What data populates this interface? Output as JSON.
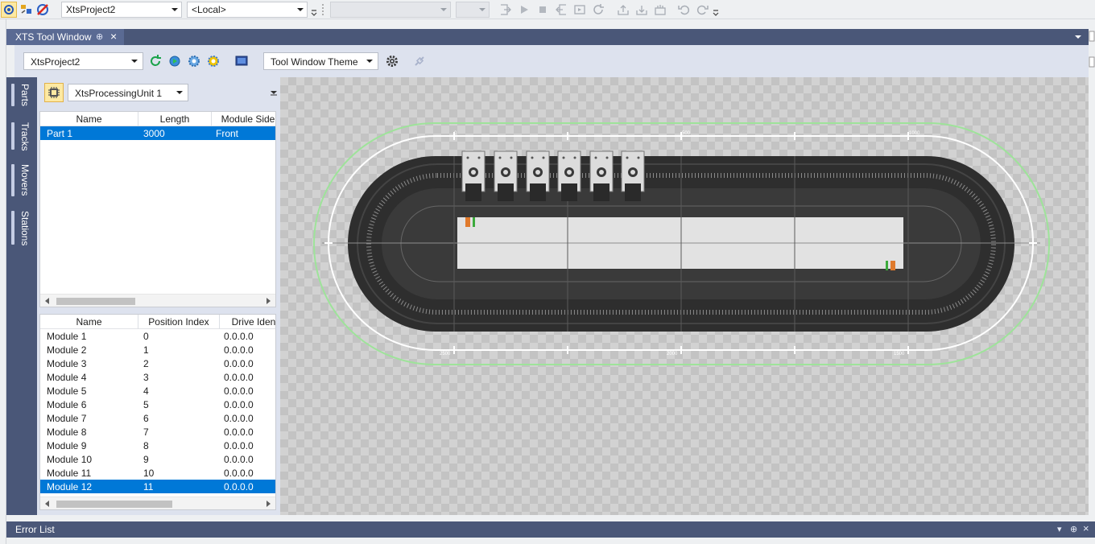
{
  "toolbar": {
    "project_combo": "XtsProject2",
    "platform_combo": "<Local>"
  },
  "tool_window": {
    "tab_title": "XTS Tool Window",
    "project_combo": "XtsProject2",
    "theme_combo": "Tool Window Theme",
    "processing_unit_combo": "XtsProcessingUnit 1"
  },
  "side_tabs": [
    "Parts",
    "Tracks",
    "Movers",
    "Stations"
  ],
  "parts_table": {
    "columns": [
      "Name",
      "Length",
      "Module Side"
    ],
    "rows": [
      {
        "name": "Part 1",
        "length": "3000",
        "side": "Front"
      }
    ]
  },
  "modules_table": {
    "columns": [
      "Name",
      "Position Index",
      "Drive Identi"
    ],
    "rows": [
      {
        "name": "Module 1",
        "index": "0",
        "drive": "0.0.0.0"
      },
      {
        "name": "Module 2",
        "index": "1",
        "drive": "0.0.0.0"
      },
      {
        "name": "Module 3",
        "index": "2",
        "drive": "0.0.0.0"
      },
      {
        "name": "Module 4",
        "index": "3",
        "drive": "0.0.0.0"
      },
      {
        "name": "Module 5",
        "index": "4",
        "drive": "0.0.0.0"
      },
      {
        "name": "Module 6",
        "index": "5",
        "drive": "0.0.0.0"
      },
      {
        "name": "Module 7",
        "index": "6",
        "drive": "0.0.0.0"
      },
      {
        "name": "Module 8",
        "index": "7",
        "drive": "0.0.0.0"
      },
      {
        "name": "Module 9",
        "index": "8",
        "drive": "0.0.0.0"
      },
      {
        "name": "Module 10",
        "index": "9",
        "drive": "0.0.0.0"
      },
      {
        "name": "Module 11",
        "index": "10",
        "drive": "0.0.0.0"
      },
      {
        "name": "Module 12",
        "index": "11",
        "drive": "0.0.0.0"
      }
    ],
    "selected_row": "Module 12"
  },
  "track": {
    "top_scale_labels": [
      "0",
      "500",
      "1000"
    ],
    "bottom_scale_labels": [
      "2500",
      "2000",
      "1500"
    ],
    "mover_count": 6
  },
  "bottom_panel": {
    "title": "Error List"
  },
  "colors": {
    "accent_blue": "#0078d7",
    "chrome_dark": "#4a5778",
    "toolbar_bg": "#dde2ee",
    "track_outline_green": "#9ee39a"
  }
}
